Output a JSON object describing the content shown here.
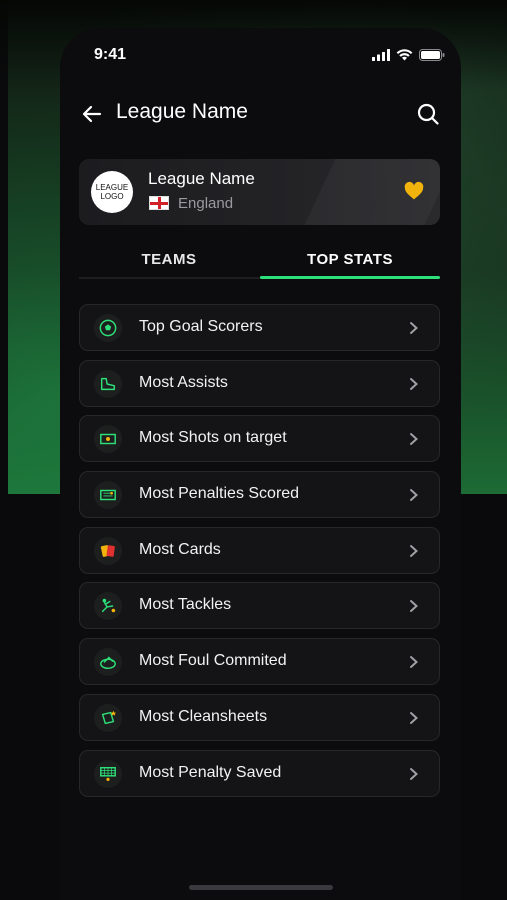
{
  "status_bar": {
    "time": "9:41"
  },
  "header": {
    "title": "League Name"
  },
  "league": {
    "logo_text": "LEAGUE LOGO",
    "name": "League Name",
    "country": "England",
    "favorite_color": "#f2b40c"
  },
  "tabs": [
    {
      "label": "TEAMS",
      "active": false
    },
    {
      "label": "TOP STATS",
      "active": true
    }
  ],
  "accent_color": "#2ee07a",
  "stats": [
    {
      "label": "Top Goal Scorers",
      "icon": "soccer-ball-icon"
    },
    {
      "label": "Most Assists",
      "icon": "boot-icon"
    },
    {
      "label": "Most Shots on target",
      "icon": "goal-target-icon"
    },
    {
      "label": "Most Penalties Scored",
      "icon": "penalty-goal-icon"
    },
    {
      "label": "Most Cards",
      "icon": "cards-icon"
    },
    {
      "label": "Most Tackles",
      "icon": "tackle-icon"
    },
    {
      "label": "Most Foul Commited",
      "icon": "foul-icon"
    },
    {
      "label": "Most Cleansheets",
      "icon": "cleansheet-icon"
    },
    {
      "label": "Most Penalty Saved",
      "icon": "penalty-save-icon"
    }
  ]
}
